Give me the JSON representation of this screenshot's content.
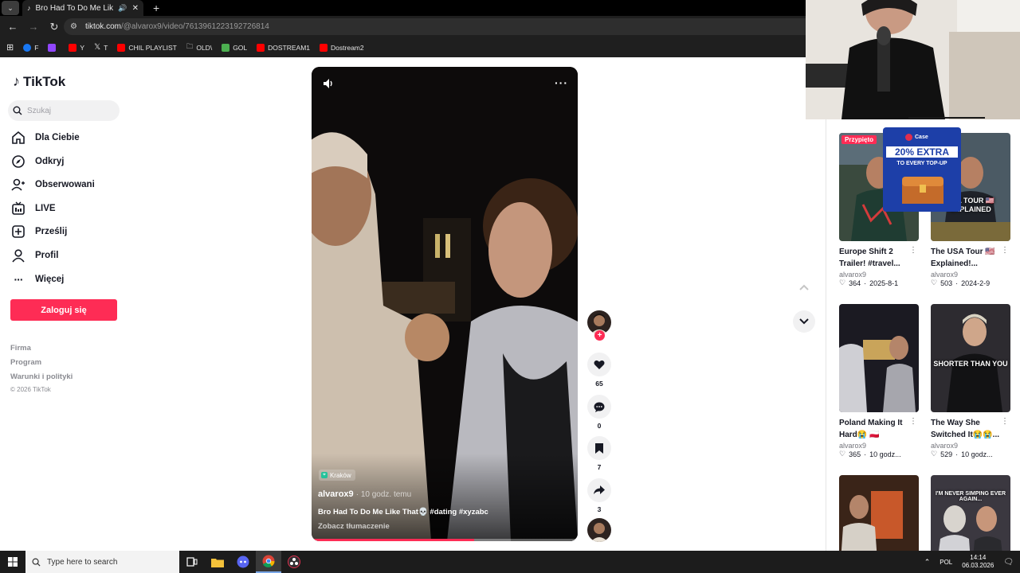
{
  "browser": {
    "tab_title": "Bro Had To Do Me Like That",
    "url_host": "tiktok.com",
    "url_path": "/@alvarox9/video/7613961223192726814",
    "bookmarks": [
      {
        "label": "F",
        "color": "#1877f2"
      },
      {
        "label": "",
        "color": "#9146ff"
      },
      {
        "label": "Y",
        "color": "#ff0000"
      },
      {
        "label": "T",
        "color": "#ffffff"
      },
      {
        "label": "CHIL PLAYLIST",
        "color": "#ff0000"
      },
      {
        "label": "OLD\\",
        "color": "#cccccc"
      },
      {
        "label": "GOL",
        "color": "#4caf50"
      },
      {
        "label": "DOSTREAM1",
        "color": "#ff0000"
      },
      {
        "label": "Dostream2",
        "color": "#ff0000"
      }
    ]
  },
  "sidebar": {
    "logo": "TikTok",
    "search_placeholder": "Szukaj",
    "nav": [
      {
        "label": "Dla Ciebie",
        "icon": "home-icon"
      },
      {
        "label": "Odkryj",
        "icon": "compass-icon"
      },
      {
        "label": "Obserwowani",
        "icon": "following-icon"
      },
      {
        "label": "LIVE",
        "icon": "live-icon"
      },
      {
        "label": "Prześlij",
        "icon": "upload-icon"
      },
      {
        "label": "Profil",
        "icon": "profile-icon"
      },
      {
        "label": "Więcej",
        "icon": "more-icon"
      }
    ],
    "login_label": "Zaloguj się",
    "footer": [
      "Firma",
      "Program",
      "Warunki i polityki",
      "© 2026 TikTok"
    ]
  },
  "video": {
    "location": "Kraków",
    "author": "alvarox9",
    "time_ago": "· 10 godz. temu",
    "description": "Bro Had To Do Me Like That💀 #dating #xyzabc",
    "translate": "Zobacz tłumaczenie",
    "progress": 0.61
  },
  "actions": {
    "likes": "65",
    "comments": "0",
    "saves": "7",
    "shares": "3"
  },
  "related": [
    {
      "title": "Europe Shift 2 Trailer! #travel...",
      "author": "alvarox9",
      "likes": "364",
      "date": "2025-8-1",
      "pinned": "Przypięto",
      "caption": "",
      "color": "#3a4a3e"
    },
    {
      "title": "The USA Tour 🇺🇸 Explained!...",
      "author": "alvarox9",
      "likes": "503",
      "date": "2024-2-9",
      "pinned": "",
      "caption": "USA TOUR 🇺🇸 EXPLAINED",
      "color": "#4b5a64"
    },
    {
      "title": "Poland Making It Hard😭 🇵🇱 #datin...",
      "author": "alvarox9",
      "likes": "365",
      "date": "10 godz...",
      "pinned": "",
      "caption": "",
      "color": "#1b1a22"
    },
    {
      "title": "The Way She Switched It😭😭...",
      "author": "alvarox9",
      "likes": "529",
      "date": "10 godz...",
      "pinned": "",
      "caption": "SHORTER THAN YOU",
      "color": "#2d2b30"
    },
    {
      "title": "",
      "author": "",
      "likes": "",
      "date": "",
      "pinned": "",
      "caption": "",
      "color": "#3a2418"
    },
    {
      "title": "",
      "author": "",
      "likes": "",
      "date": "",
      "pinned": "",
      "caption": "I'M NEVER SIMPING EVER AGAIN...",
      "color": "#3b3840"
    }
  ],
  "ad": {
    "brand": "Case",
    "headline": "20% EXTRA",
    "sub": "TO EVERY TOP-UP"
  },
  "taskbar": {
    "search_placeholder": "Type here to search",
    "lang": "POL",
    "time": "14:14",
    "date": "06.03.2026"
  },
  "colors": {
    "accent": "#fe2c55",
    "text": "#161823"
  }
}
